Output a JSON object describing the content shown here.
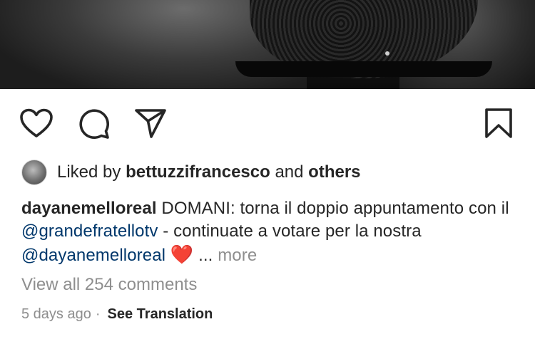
{
  "post": {
    "actions": {
      "like_icon": "heart-outline",
      "comment_icon": "speech-bubble",
      "share_icon": "paper-plane",
      "save_icon": "bookmark-outline"
    },
    "likes": {
      "prefix": "Liked by",
      "user": "bettuzzifrancesco",
      "joiner": "and",
      "others": "others"
    },
    "caption": {
      "username": "dayanemelloreal",
      "text_1": "DOMANI: torna il doppio appuntamento con il",
      "mention_1": "@grandefratellotv",
      "text_2": "- continuate a votare per la nostra",
      "mention_2": "@dayanemelloreal",
      "emoji": "❤️",
      "ellipsis": "...",
      "more_label": "more"
    },
    "comments_link": "View all 254 comments",
    "timestamp": "5 days ago",
    "separator": "·",
    "see_translation": "See Translation"
  },
  "colors": {
    "text": "#262626",
    "secondary": "#8e8e8e",
    "mention": "#00376b",
    "heart": "#ed1c24"
  }
}
